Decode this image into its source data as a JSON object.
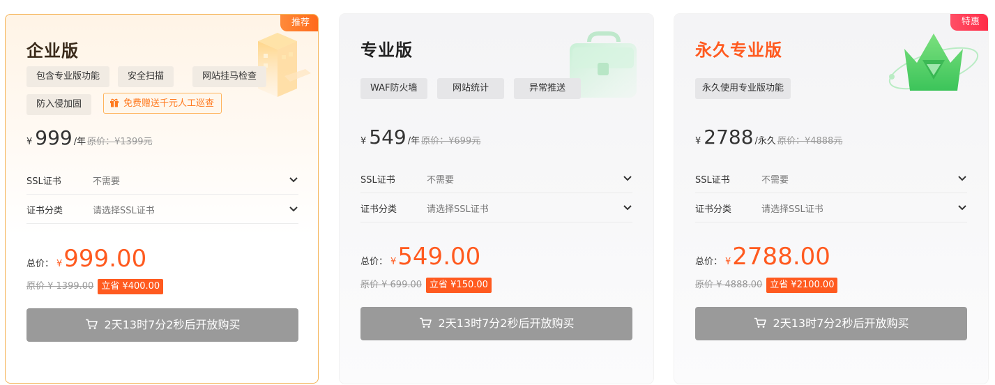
{
  "currency": "¥",
  "plans": [
    {
      "corner": "推荐",
      "title": "企业版",
      "tags": [
        "包含专业版功能",
        "安全扫描",
        "网站挂马检查",
        "防入侵加固"
      ],
      "gift": "免费赠送千元人工巡查",
      "price": "999",
      "unit": "/年",
      "orig": "原价：¥1399元",
      "ssl_label": "SSL证书",
      "ssl_value": "不需要",
      "cat_label": "证书分类",
      "cat_value": "请选择SSL证书",
      "total_label": "总价：",
      "total": "999.00",
      "orig_total": "原价 ¥ 1399.00",
      "save": "立省 ¥400.00",
      "button": "2天13时7分2秒后开放购买"
    },
    {
      "corner": "",
      "title": "专业版",
      "tags": [
        "WAF防火墙",
        "网站统计",
        "异常推送"
      ],
      "price": "549",
      "unit": "/年",
      "orig": "原价：¥699元",
      "ssl_label": "SSL证书",
      "ssl_value": "不需要",
      "cat_label": "证书分类",
      "cat_value": "请选择SSL证书",
      "total_label": "总价：",
      "total": "549.00",
      "orig_total": "原价 ¥ 699.00",
      "save": "立省 ¥150.00",
      "button": "2天13时7分2秒后开放购买"
    },
    {
      "corner": "特惠",
      "title": "永久专业版",
      "tags": [
        "永久使用专业版功能"
      ],
      "price": "2788",
      "unit": "/永久",
      "orig": "原价：¥4888元",
      "ssl_label": "SSL证书",
      "ssl_value": "不需要",
      "cat_label": "证书分类",
      "cat_value": "请选择SSL证书",
      "total_label": "总价：",
      "total": "2788.00",
      "orig_total": "原价 ¥ 4888.00",
      "save": "立省 ¥2100.00",
      "button": "2天13时7分2秒后开放购买"
    }
  ],
  "colors": {
    "accent_orange": "#ff5a1f",
    "button_disabled": "#9a9a9a",
    "recommend_border": "#f5b55a"
  },
  "icons": {
    "gift": "gift-icon",
    "chevron": "chevron-down-icon",
    "cart": "shopping-cart-icon"
  }
}
